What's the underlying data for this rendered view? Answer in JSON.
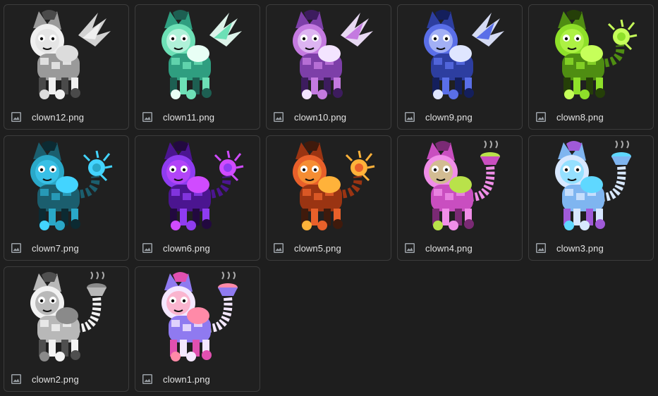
{
  "files": [
    {
      "name": "clown12.png",
      "icon": "image-icon",
      "palette": {
        "a": "#f0f0f0",
        "b": "#9a9a9a",
        "c": "#4a4a4a",
        "d": "#dcdcdc"
      },
      "style": "tuft"
    },
    {
      "name": "clown11.png",
      "icon": "image-icon",
      "palette": {
        "a": "#6de0b6",
        "b": "#2f9e80",
        "c": "#1d5f52",
        "d": "#e8fff5"
      },
      "style": "tuft"
    },
    {
      "name": "clown10.png",
      "icon": "image-icon",
      "palette": {
        "a": "#c47ae0",
        "b": "#7d3fa8",
        "c": "#3d1c5e",
        "d": "#f3e4ff"
      },
      "style": "tuft"
    },
    {
      "name": "clown9.png",
      "icon": "image-icon",
      "palette": {
        "a": "#5a6fe8",
        "b": "#2d3ea0",
        "c": "#141f5c",
        "d": "#dfe6ff"
      },
      "style": "tuft"
    },
    {
      "name": "clown8.png",
      "icon": "image-icon",
      "palette": {
        "a": "#8fe02a",
        "b": "#4f8d12",
        "c": "#253f08",
        "d": "#c6ff5a"
      },
      "style": "burst"
    },
    {
      "name": "clown7.png",
      "icon": "image-icon",
      "palette": {
        "a": "#2aa8c8",
        "b": "#1b5e6e",
        "c": "#0c2a32",
        "d": "#43d4ff"
      },
      "style": "burst"
    },
    {
      "name": "clown6.png",
      "icon": "image-icon",
      "palette": {
        "a": "#8f3cf0",
        "b": "#4b1590",
        "c": "#22093f",
        "d": "#d04bff"
      },
      "style": "burst"
    },
    {
      "name": "clown5.png",
      "icon": "image-icon",
      "palette": {
        "a": "#e8602a",
        "b": "#9a3412",
        "c": "#3f1a0c",
        "d": "#ffb23a"
      },
      "style": "burst"
    },
    {
      "name": "clown4.png",
      "icon": "image-icon",
      "palette": {
        "a": "#f08ee8",
        "b": "#c94ec0",
        "c": "#7a2a74",
        "d": "#b9e24a"
      },
      "style": "pie"
    },
    {
      "name": "clown3.png",
      "icon": "image-icon",
      "palette": {
        "a": "#d8e8ff",
        "b": "#7fb5f0",
        "c": "#a05ad8",
        "d": "#5fd8ff"
      },
      "style": "pie"
    },
    {
      "name": "clown2.png",
      "icon": "image-icon",
      "palette": {
        "a": "#f2f2f2",
        "b": "#b8b8b8",
        "c": "#4f4f4f",
        "d": "#8a8a8a"
      },
      "style": "pie"
    },
    {
      "name": "clown1.png",
      "icon": "image-icon",
      "palette": {
        "a": "#f4e8ff",
        "b": "#8f7af0",
        "c": "#e050b0",
        "d": "#ff8aa8"
      },
      "style": "pie"
    }
  ]
}
